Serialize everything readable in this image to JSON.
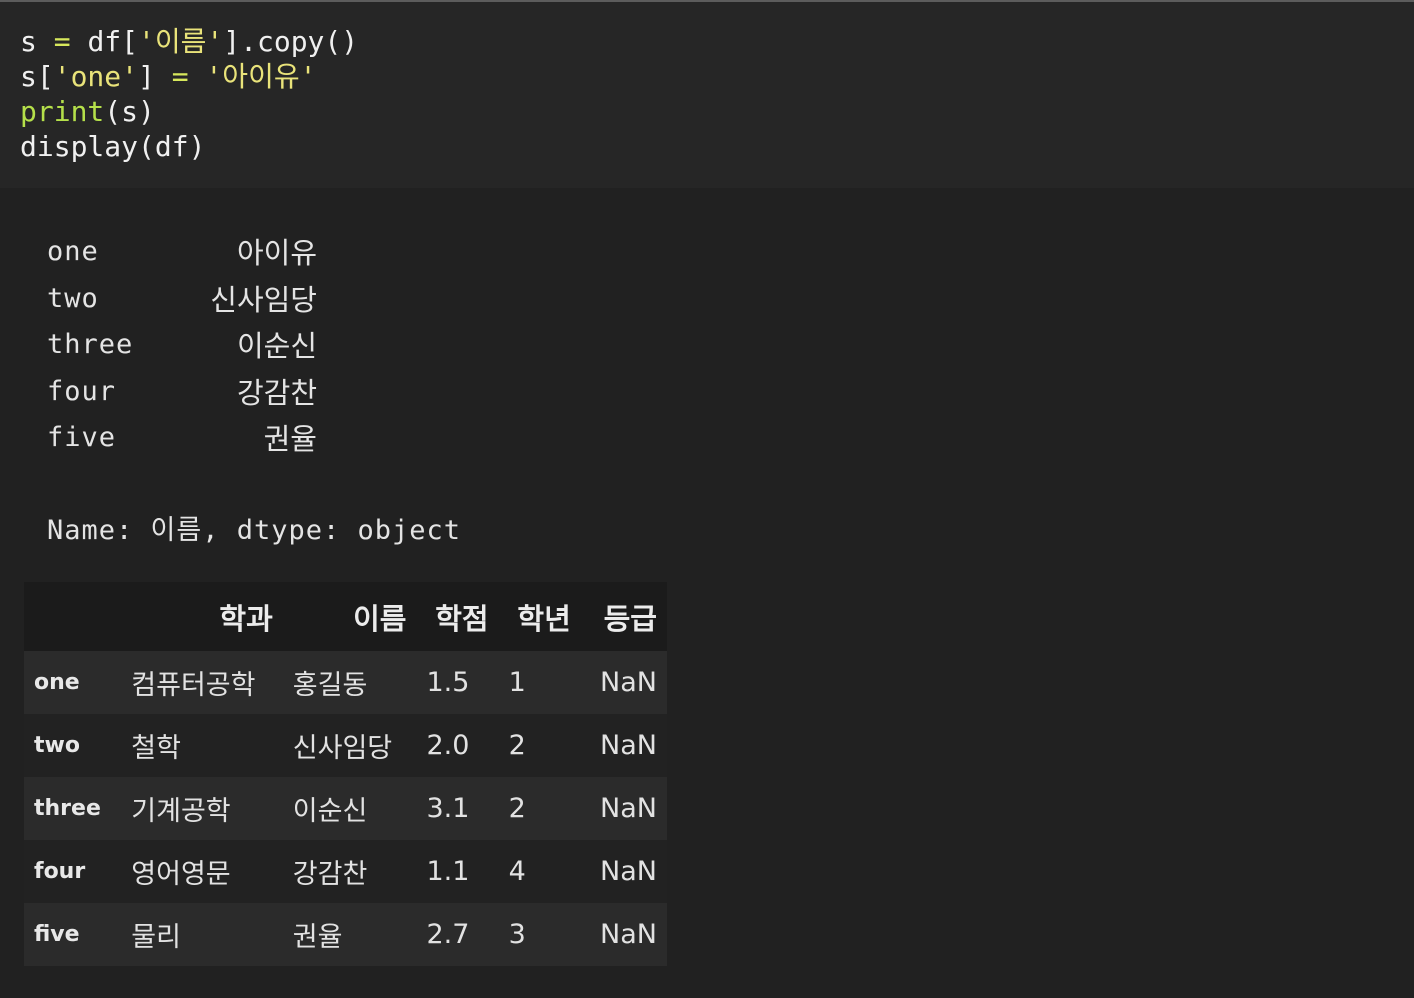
{
  "code": {
    "line1": {
      "a": "s",
      "b": " = ",
      "c": "df[",
      "d": "'이름'",
      "e": "].copy()"
    },
    "line2": {
      "a": "s[",
      "b": "'one'",
      "c": "] ",
      "d": "=",
      "e": " ",
      "f": "'아이유'"
    },
    "line3": {
      "a": "print",
      "b": "(s)"
    },
    "line4": {
      "a": "display(df)"
    }
  },
  "series_output": {
    "rows": [
      {
        "index": "one",
        "value": "아이유"
      },
      {
        "index": "two",
        "value": "신사임당"
      },
      {
        "index": "three",
        "value": "이순신"
      },
      {
        "index": "four",
        "value": "강감찬"
      },
      {
        "index": "five",
        "value": "권율"
      }
    ],
    "footer": "Name: 이름, dtype: object"
  },
  "dataframe": {
    "columns": [
      "",
      "학과",
      "이름",
      "학점",
      "학년",
      "등급"
    ],
    "rows": [
      {
        "index": "one",
        "cells": [
          "컴퓨터공학",
          "홍길동",
          "1.5",
          "1",
          "NaN"
        ]
      },
      {
        "index": "two",
        "cells": [
          "철학",
          "신사임당",
          "2.0",
          "2",
          "NaN"
        ]
      },
      {
        "index": "three",
        "cells": [
          "기계공학",
          "이순신",
          "3.1",
          "2",
          "NaN"
        ]
      },
      {
        "index": "four",
        "cells": [
          "영어영문",
          "강감찬",
          "1.1",
          "4",
          "NaN"
        ]
      },
      {
        "index": "five",
        "cells": [
          "물리",
          "권율",
          "2.7",
          "3",
          "NaN"
        ]
      }
    ]
  },
  "colors": {
    "code_bg": "#262626",
    "output_bg": "#212121",
    "operator": "#d7e85c",
    "string": "#e9e37a",
    "builtin": "#b5e04a"
  }
}
